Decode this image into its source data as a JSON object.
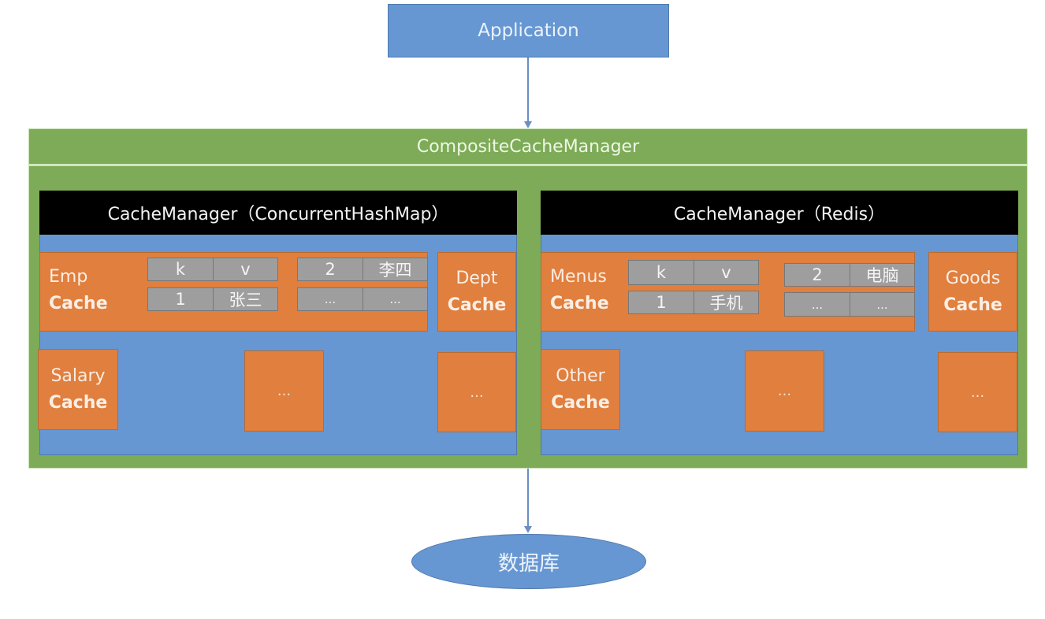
{
  "application": {
    "label": "Application"
  },
  "composite": {
    "title": "CompositeCacheManager"
  },
  "left_manager": {
    "title": "CacheManager（ConcurrentHashMap）",
    "caches": {
      "emp": {
        "name": "Emp",
        "suffix": "Cache"
      },
      "dept": {
        "name": "Dept",
        "suffix": "Cache"
      },
      "salary": {
        "name": "Salary",
        "suffix": "Cache"
      },
      "more1": {
        "label": "..."
      },
      "more2": {
        "label": "..."
      }
    },
    "table1": [
      [
        "k",
        "v"
      ],
      [
        "1",
        "张三"
      ]
    ],
    "table2": [
      [
        "2",
        "李四"
      ],
      [
        "...",
        "..."
      ]
    ]
  },
  "right_manager": {
    "title": "CacheManager（Redis）",
    "caches": {
      "menus": {
        "name": "Menus",
        "suffix": "Cache"
      },
      "goods": {
        "name": "Goods",
        "suffix": "Cache"
      },
      "other": {
        "name": "Other",
        "suffix": "Cache"
      },
      "more1": {
        "label": "..."
      },
      "more2": {
        "label": "..."
      }
    },
    "table1": [
      [
        "k",
        "v"
      ],
      [
        "1",
        "手机"
      ]
    ],
    "table2": [
      [
        "2",
        "电脑"
      ],
      [
        "...",
        "..."
      ]
    ]
  },
  "database": {
    "label": "数据库"
  },
  "colors": {
    "blue": "#6797d2",
    "green": "#7dab57",
    "orange": "#e07f3e",
    "gray": "#9e9e9e",
    "black": "#000000"
  }
}
